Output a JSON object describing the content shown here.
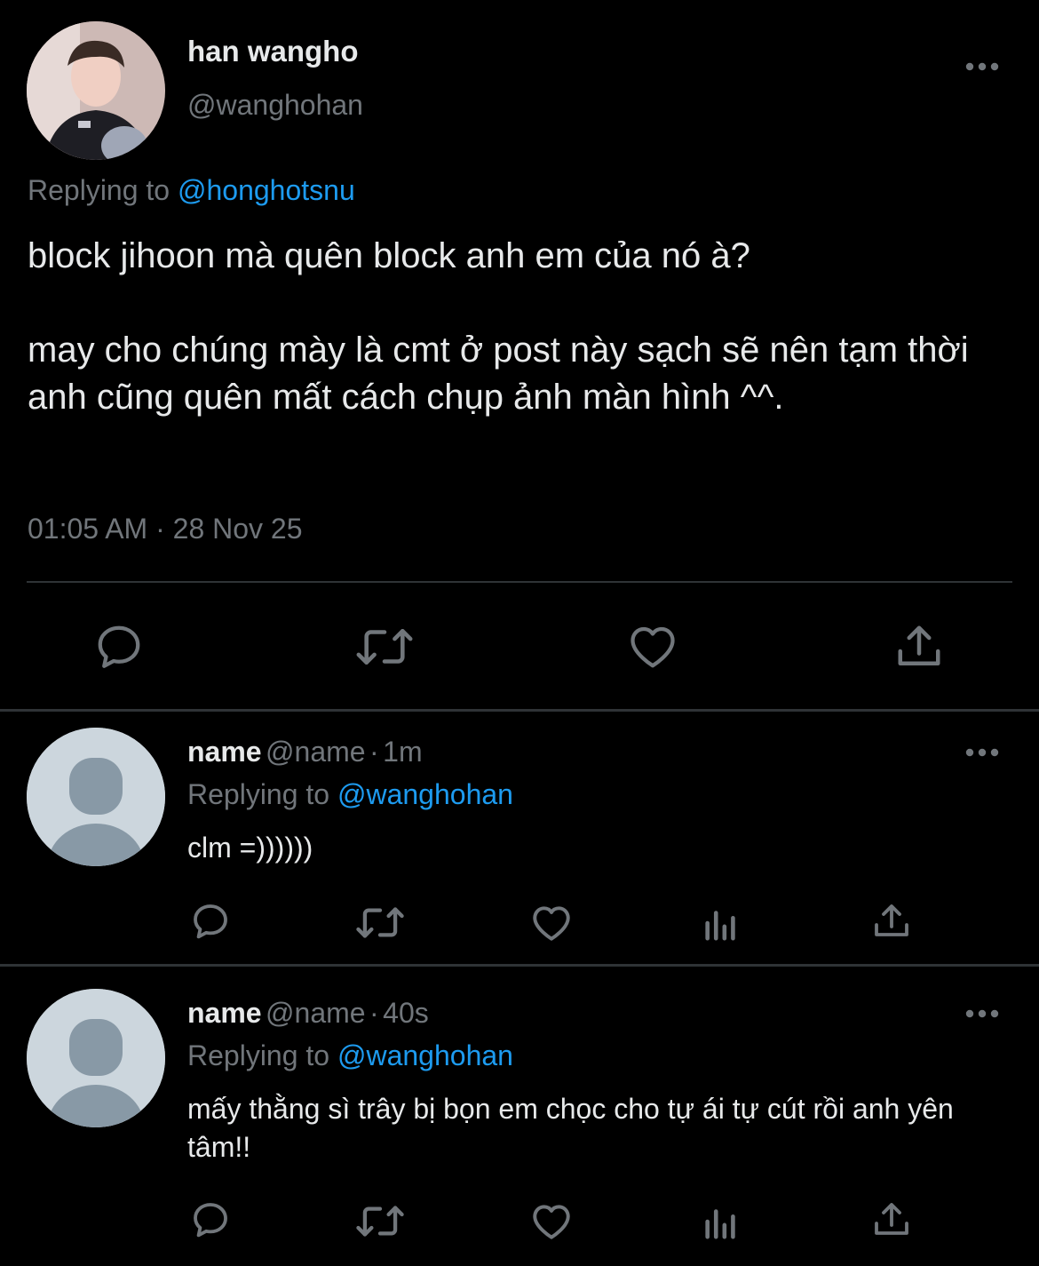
{
  "tweet": {
    "display_name": "han wangho",
    "handle": "@wanghohan",
    "replying_prefix": "Replying to",
    "replying_to": "@honghotsnu",
    "text": "block jihoon mà quên block anh em của nó à?\n\nmay cho chúng mày là cmt ở post này sạch sẽ nên tạm thời anh cũng quên mất cách chụp ảnh màn hình ^^.",
    "timestamp": "01:05 AM · 28 Nov 25",
    "actions": [
      "reply-icon",
      "retweet-icon",
      "like-icon",
      "share-icon"
    ]
  },
  "replies": [
    {
      "name": "name",
      "handle": "@name",
      "time_sep": "·",
      "time": "1m",
      "replying_prefix": "Replying to",
      "replying_to": "@wanghohan",
      "text": "clm =))))))"
    },
    {
      "name": "name",
      "handle": "@name",
      "time_sep": "·",
      "time": "40s",
      "replying_prefix": "Replying to",
      "replying_to": "@wanghohan",
      "text": "mấy thằng sì trây bị bọn em chọc cho tự ái tự cút rồi anh yên tâm!!"
    }
  ],
  "colors": {
    "background": "#000000",
    "text": "#e7e9ea",
    "muted": "#71767b",
    "link": "#1d9bf0",
    "divider": "#2f3336",
    "default_avatar_bg": "#ccd6dd",
    "default_avatar_fg": "#8899a6"
  }
}
